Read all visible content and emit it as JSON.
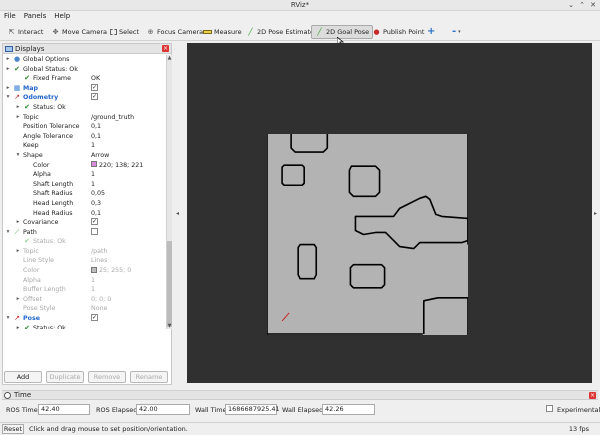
{
  "window": {
    "title": "RViz*"
  },
  "menu": [
    "File",
    "Panels",
    "Help"
  ],
  "toolbar": {
    "interact": "Interact",
    "move_camera": "Move Camera",
    "select": "Select",
    "focus_camera": "Focus Camera",
    "measure": "Measure",
    "pose_estimate": "2D Pose Estimate",
    "goal_pose": "2D Goal Pose",
    "publish_point": "Publish Point",
    "add_icon": "+",
    "remove_icon": "-"
  },
  "displays": {
    "title": "Displays",
    "rows": [
      {
        "label": "Global Options",
        "value": ""
      },
      {
        "label": "Global Status: Ok",
        "value": ""
      },
      {
        "label": "Fixed Frame",
        "value": "OK"
      },
      {
        "label": "Map",
        "value": ""
      },
      {
        "label": "Odometry",
        "value": ""
      },
      {
        "label": "Status: Ok",
        "value": ""
      },
      {
        "label": "Topic",
        "value": "/ground_truth"
      },
      {
        "label": "Position Tolerance",
        "value": "0,1"
      },
      {
        "label": "Angle Tolerance",
        "value": "0,1"
      },
      {
        "label": "Keep",
        "value": "1"
      },
      {
        "label": "Shape",
        "value": "Arrow"
      },
      {
        "label": "Color",
        "value": "220; 138; 221"
      },
      {
        "label": "Alpha",
        "value": "1"
      },
      {
        "label": "Shaft Length",
        "value": "1"
      },
      {
        "label": "Shaft Radius",
        "value": "0,05"
      },
      {
        "label": "Head Length",
        "value": "0,3"
      },
      {
        "label": "Head Radius",
        "value": "0,1"
      },
      {
        "label": "Covariance",
        "value": ""
      },
      {
        "label": "Path",
        "value": ""
      },
      {
        "label": "Status: Ok",
        "value": ""
      },
      {
        "label": "Topic",
        "value": "/path"
      },
      {
        "label": "Line Style",
        "value": "Lines"
      },
      {
        "label": "Color",
        "value": "25; 255; 0"
      },
      {
        "label": "Alpha",
        "value": "1"
      },
      {
        "label": "Buffer Length",
        "value": "1"
      },
      {
        "label": "Offset",
        "value": "0; 0; 0"
      },
      {
        "label": "Pose Style",
        "value": "None"
      },
      {
        "label": "Pose",
        "value": ""
      },
      {
        "label": "Status: Ok",
        "value": ""
      }
    ],
    "colors": {
      "odometry": "#dc8add",
      "path": "#19ff00"
    },
    "buttons": {
      "add": "Add",
      "duplicate": "Duplicate",
      "remove": "Remove",
      "rename": "Rename"
    }
  },
  "time": {
    "title": "Time",
    "ros_time_label": "ROS Time:",
    "ros_time": "42.40",
    "ros_elapsed_label": "ROS Elapsed:",
    "ros_elapsed": "42.00",
    "wall_time_label": "Wall Time:",
    "wall_time": "1686687925.41",
    "wall_elapsed_label": "Wall Elapsed:",
    "wall_elapsed": "42.26",
    "experimental": "Experimental"
  },
  "status": {
    "reset": "Reset",
    "message": "Click and drag mouse to set position/orientation.",
    "fps": "13 fps"
  }
}
